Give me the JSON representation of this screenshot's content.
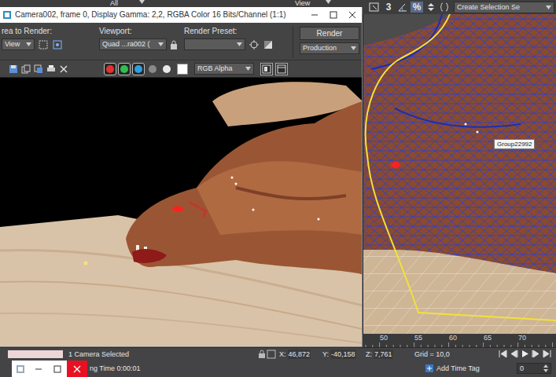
{
  "app_toolbar": {
    "selection_filter": "All",
    "reference_coord": "View",
    "snap": "3",
    "percent_snap": "%",
    "selection_set": "Create Selection Se"
  },
  "render_window": {
    "title": "Camera002, frame 0, Display Gamma: 2,2, RGBA Color 16 Bits/Channel (1:1)",
    "area_label": "rea to Render:",
    "area_value": "View",
    "viewport_label": "Viewport:",
    "viewport_value": "Quad ...ra002 (",
    "preset_label": "Render Preset:",
    "preset_value": "",
    "render_button": "Render",
    "mode_value": "Production",
    "channels": [
      {
        "name": "red",
        "selected": true,
        "color": "#e53030"
      },
      {
        "name": "green",
        "selected": true,
        "color": "#2fbf4f"
      },
      {
        "name": "blue",
        "selected": true,
        "color": "#2f9fe0"
      },
      {
        "name": "alpha",
        "selected": false,
        "color": "#8a8a8a"
      },
      {
        "name": "monochrome",
        "selected": false,
        "color": "#e8e8e8"
      }
    ],
    "display_value": "RGB Alpha"
  },
  "viewport": {
    "tooltip": "Group22992"
  },
  "timeline": {
    "ticks": [
      "50",
      "55",
      "60",
      "65",
      "70"
    ]
  },
  "status_bar": {
    "prompt": "1 Camera Selected",
    "time": "ng Time 0:00:01",
    "coords": [
      {
        "label": "X:",
        "value": "46,872"
      },
      {
        "label": "Y:",
        "value": "-40,158"
      },
      {
        "label": "Z:",
        "value": "7,761"
      }
    ],
    "grid": "Grid = 10,0",
    "add_time_tag": "Add Time Tag",
    "frame": "0"
  }
}
